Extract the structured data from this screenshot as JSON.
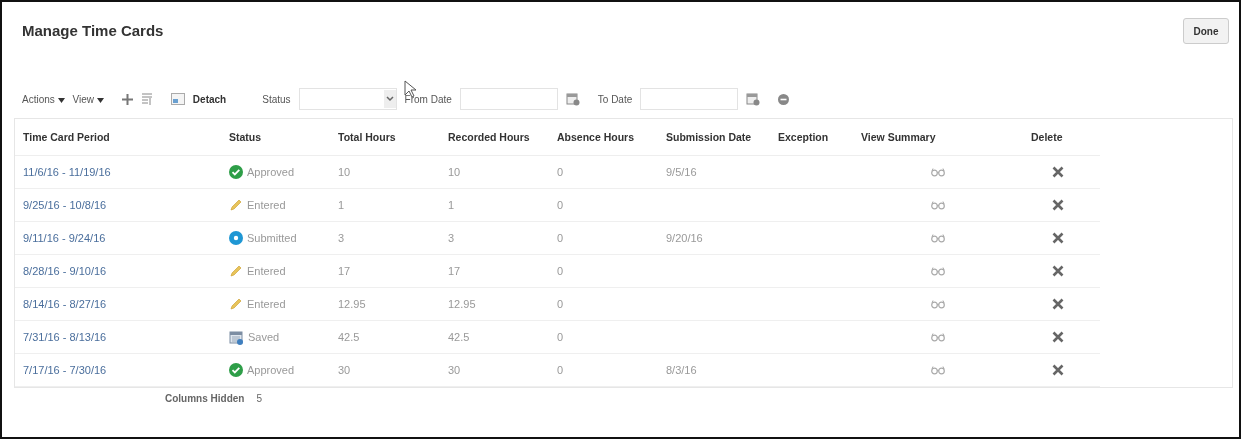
{
  "page": {
    "title": "Manage Time Cards",
    "done_button": "Done"
  },
  "toolbar": {
    "actions_menu": "Actions",
    "view_menu": "View",
    "detach_button": "Detach",
    "status_label": "Status",
    "from_date_label": "From Date",
    "to_date_label": "To Date"
  },
  "table": {
    "columns": [
      "Time Card Period",
      "Status",
      "Total Hours",
      "Recorded Hours",
      "Absence Hours",
      "Submission Date",
      "Exception",
      "View Summary",
      "Delete"
    ],
    "rows": [
      {
        "period": "11/6/16 - 11/19/16",
        "status": {
          "kind": "approved",
          "label": "Approved"
        },
        "total_hours": "10",
        "recorded_hours": "10",
        "absence_hours": "0",
        "submission_date": "9/5/16"
      },
      {
        "period": "9/25/16 - 10/8/16",
        "status": {
          "kind": "entered",
          "label": "Entered"
        },
        "total_hours": "1",
        "recorded_hours": "1",
        "absence_hours": "0"
      },
      {
        "period": "9/11/16 - 9/24/16",
        "status": {
          "kind": "submitted",
          "label": "Submitted"
        },
        "total_hours": "3",
        "recorded_hours": "3",
        "absence_hours": "0",
        "submission_date": "9/20/16"
      },
      {
        "period": "8/28/16 - 9/10/16",
        "status": {
          "kind": "entered",
          "label": "Entered"
        },
        "total_hours": "17",
        "recorded_hours": "17",
        "absence_hours": "0"
      },
      {
        "period": "8/14/16 - 8/27/16",
        "status": {
          "kind": "entered",
          "label": "Entered"
        },
        "total_hours": "12.95",
        "recorded_hours": "12.95",
        "absence_hours": "0"
      },
      {
        "period": "7/31/16 - 8/13/16",
        "status": {
          "kind": "saved",
          "label": "Saved"
        },
        "total_hours": "42.5",
        "recorded_hours": "42.5",
        "absence_hours": "0"
      },
      {
        "period": "7/17/16 - 7/30/16",
        "status": {
          "kind": "approved",
          "label": "Approved"
        },
        "total_hours": "30",
        "recorded_hours": "30",
        "absence_hours": "0",
        "submission_date": "8/3/16"
      }
    ],
    "footer": {
      "label": "Columns Hidden",
      "count": "5"
    }
  }
}
